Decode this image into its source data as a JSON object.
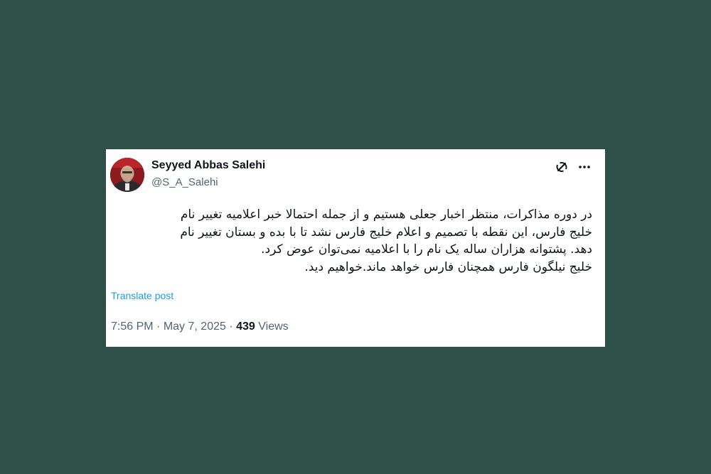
{
  "tweet": {
    "author": {
      "name": "Seyyed Abbas Salehi",
      "handle": "@S_A_Salehi"
    },
    "lines": [
      "در دوره مذاکرات، منتظر اخبار جعلی هستیم و از جمله احتمالا خبر اعلامیه تغییر نام",
      "خلیج فارس، این نقطه با تصمیم و اعلام خلیج فارس نشد تا با بده و بستان تغییر نام",
      "دهد. پشتوانه هزاران ساله یک نام را با اعلامیه نمی‌توان عوض کرد.",
      "خلیج نیلگون فارس همچنان فارس خواهد ماند.خواهیم دید."
    ],
    "translate_label": "Translate post",
    "time": "7:56 PM",
    "separator": "·",
    "date": "May 7, 2025",
    "views_count": "439",
    "views_label": "Views"
  },
  "icons": {
    "grok": "grok-icon",
    "more": "more-options-icon"
  },
  "colors": {
    "background": "#2f5049",
    "card": "#ffffff",
    "link": "#1d9bf0",
    "muted": "#536471",
    "text": "#0f1419"
  }
}
